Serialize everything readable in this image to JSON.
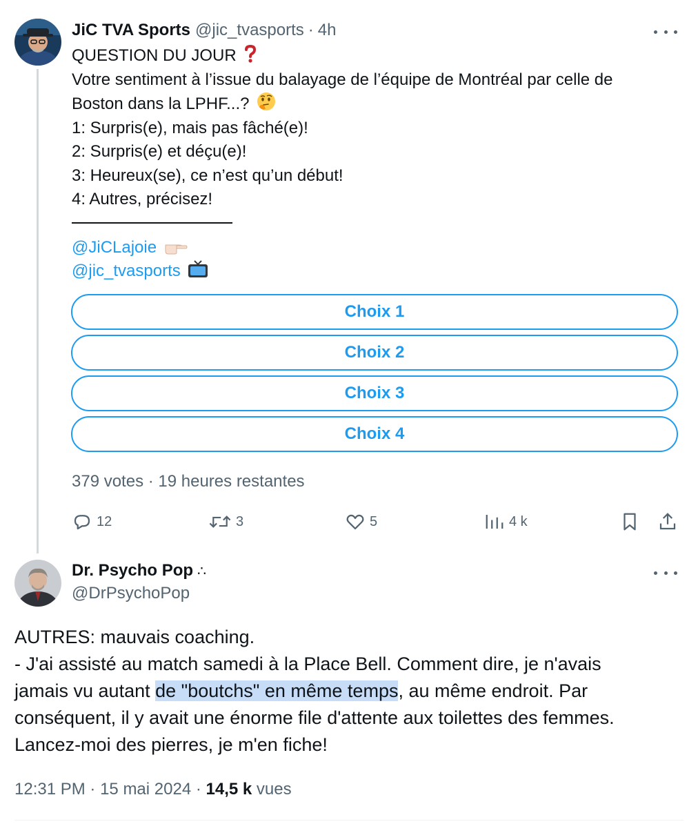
{
  "tweet1": {
    "display_name": "JiC TVA Sports",
    "handle": "@jic_tvasports",
    "separator": "·",
    "time": "4h",
    "lines": [
      "QUESTION DU JOUR",
      "Votre sentiment à l’issue du balayage de l’équipe de Montréal par celle de",
      "Boston dans la LPHF...?",
      "1: Surpris(e), mais pas fâché(e)!",
      "2: Surpris(e) et déçu(e)!",
      "3: Heureux(se), ce n’est qu’un début!",
      "4: Autres, précisez!"
    ],
    "mentions": [
      "@JiCLajoie",
      "@jic_tvasports"
    ],
    "emoji_icons": [
      "red-question-mark-icon",
      "thinking-face-icon",
      "pointing-hand-icon",
      "television-icon"
    ],
    "poll": {
      "choices": [
        "Choix 1",
        "Choix 2",
        "Choix 3",
        "Choix 4"
      ],
      "meta": "379 votes · 19 heures restantes"
    },
    "actions": {
      "replies": "12",
      "reposts": "3",
      "likes": "5",
      "views": "4 k"
    }
  },
  "tweet2": {
    "display_name": "Dr. Psycho Pop",
    "name_suffix": "∴",
    "handle": "@DrPsychoPop",
    "body": {
      "line1": "AUTRES: mauvais coaching.",
      "line2": "- J'ai assisté au match samedi à la Place Bell. Comment dire, je n'avais",
      "line3_pre": "jamais vu autant ",
      "line3_highlight": "de \"boutchs\" en même temps",
      "line3_post": ", au même endroit. Par",
      "line4": "conséquent, il y avait une énorme file d'attente aux toilettes des femmes.",
      "line5": "Lancez-moi des pierres, je m'en fiche!"
    },
    "meta": {
      "time": "12:31 PM",
      "date": "15 mai 2024",
      "separator": "·",
      "views_count": "14,5 k",
      "views_label": "vues"
    }
  },
  "colors": {
    "accent": "#1d9bf0",
    "secondary_text": "#536471",
    "primary_text": "#0f1419",
    "highlight": "#c6dcf7"
  }
}
